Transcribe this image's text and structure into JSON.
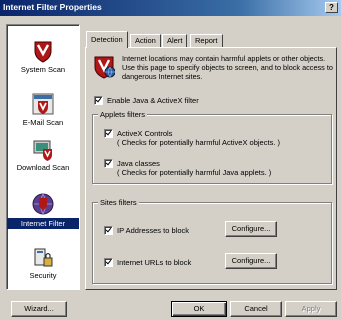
{
  "window": {
    "title": "Internet Filter Properties",
    "help_label": "?"
  },
  "sidebar": {
    "items": [
      {
        "label": "System Scan",
        "icon": "shield-icon",
        "selected": false
      },
      {
        "label": "E-Mail Scan",
        "icon": "email-scan-icon",
        "selected": false
      },
      {
        "label": "Download Scan",
        "icon": "download-scan-icon",
        "selected": false
      },
      {
        "label": "Internet Filter",
        "icon": "internet-filter-icon",
        "selected": true
      },
      {
        "label": "Security",
        "icon": "security-icon",
        "selected": false
      }
    ]
  },
  "tabs": [
    {
      "label": "Detection",
      "active": true
    },
    {
      "label": "Action",
      "active": false
    },
    {
      "label": "Alert",
      "active": false
    },
    {
      "label": "Report",
      "active": false
    }
  ],
  "detection": {
    "intro": "Internet locations may contain harmful applets or other objects. Use this page to specify objects to screen, and to block access to dangerous Internet sites.",
    "enable_java_activex": {
      "label": "Enable Java & ActiveX filter",
      "checked": true
    },
    "applets_group": {
      "title": "Applets filters",
      "activex": {
        "label": "ActiveX Controls",
        "hint": "( Checks for potentially harmful ActiveX objects. )",
        "checked": true
      },
      "java": {
        "label": "Java classes",
        "hint": "( Checks for potentially harmful Java applets. )",
        "checked": true
      }
    },
    "sites_group": {
      "title": "Sites filters",
      "ip": {
        "label": "IP Addresses to block",
        "checked": true,
        "button": "Configure..."
      },
      "urls": {
        "label": "Internet URLs to block",
        "checked": true,
        "button": "Configure..."
      }
    }
  },
  "footer": {
    "wizard": "Wizard...",
    "ok": "OK",
    "cancel": "Cancel",
    "apply": "Apply"
  },
  "colors": {
    "title_start": "#0a246a",
    "title_end": "#a6caf0",
    "face": "#d4d0c8",
    "shield_red": "#b01818"
  }
}
